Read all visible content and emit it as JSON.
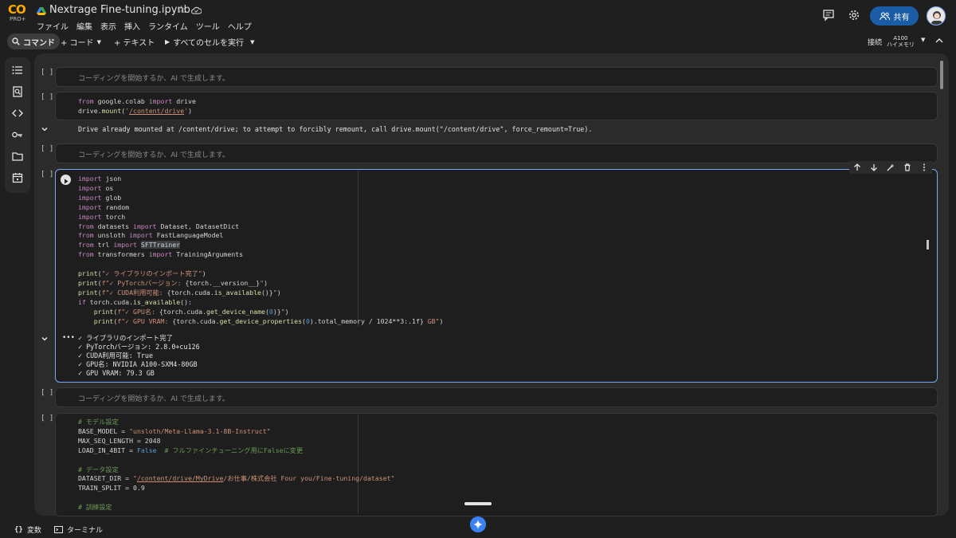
{
  "header": {
    "logo_text": "CO",
    "logo_badge": "PRO+",
    "notebook_title": "Nextrage Fine-tuning.ipynb",
    "menu": [
      "ファイル",
      "編集",
      "表示",
      "挿入",
      "ランタイム",
      "ツール",
      "ヘルプ"
    ],
    "share_label": "共有"
  },
  "toolbar": {
    "command_label": "コマンド",
    "code_label": "+ コード",
    "text_label": "+ テキスト",
    "run_all_label": "すべてのセルを実行",
    "connect_label": "接続",
    "runtime_gpu": "A100",
    "runtime_memory": "ハイメモリ"
  },
  "sidebar": {
    "items": [
      "toc-icon",
      "search-icon",
      "code-snippets-icon",
      "secrets-key-icon",
      "folder-icon",
      "calendar-icon"
    ]
  },
  "cells": {
    "bracket": "[ ]",
    "placeholder": "コーディングを開始するか、AI で生成します。",
    "cell2_lines": [
      "from google.colab import drive",
      "drive.mount('/content/drive')"
    ],
    "cell2_output": "Drive already mounted at /content/drive; to attempt to forcibly remount, call drive.mount(\"/content/drive\", force_remount=True).",
    "cell4_output": [
      "✓ ライブラリのインポート完了",
      "✓ PyTorchバージョン: 2.8.0+cu126",
      "✓ CUDA利用可能: True",
      "✓ GPU名: NVIDIA A100-SXM4-80GB",
      "✓ GPU VRAM: 79.3 GB"
    ]
  },
  "statusbar": {
    "variables_label": "変数",
    "terminal_label": "ターミナル"
  },
  "colors": {
    "accent": "#1a5ca6",
    "active_border": "#7aaaf0",
    "logo": "#f9ab00",
    "gemini": "#3b82f6"
  }
}
